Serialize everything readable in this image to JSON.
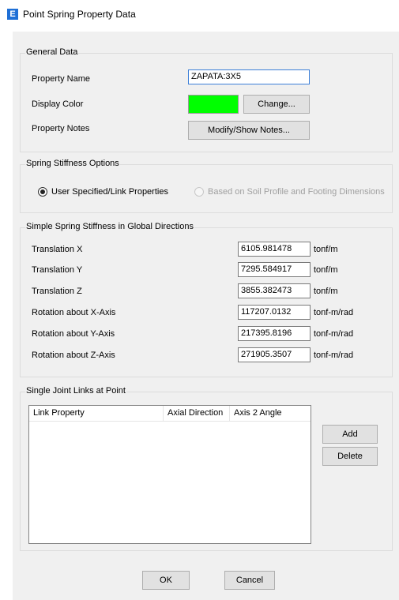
{
  "window": {
    "title": "Point Spring Property Data",
    "icon_letter": "E",
    "accent": "#1e6fd6"
  },
  "general": {
    "title": "General Data",
    "property_name_label": "Property Name",
    "property_name_value": "ZAPATA:3X5",
    "display_color_label": "Display Color",
    "display_color": "#00ff00",
    "change_button": "Change...",
    "property_notes_label": "Property Notes",
    "notes_button": "Modify/Show Notes..."
  },
  "stiffness_options": {
    "title": "Spring Stiffness Options",
    "option1": "User Specified/Link Properties",
    "option2": "Based on Soil Profile and Footing Dimensions",
    "selected": "option1"
  },
  "stiffness": {
    "title": "Simple Spring Stiffness in Global Directions",
    "rows": [
      {
        "label": "Translation  X",
        "value": "6105.981478",
        "unit": "tonf/m"
      },
      {
        "label": "Translation  Y",
        "value": "7295.584917",
        "unit": "tonf/m"
      },
      {
        "label": "Translation  Z",
        "value": "3855.382473",
        "unit": "tonf/m"
      },
      {
        "label": "Rotation about  X-Axis",
        "value": "117207.0132",
        "unit": "tonf-m/rad"
      },
      {
        "label": "Rotation about  Y-Axis",
        "value": "217395.8196",
        "unit": "tonf-m/rad"
      },
      {
        "label": "Rotation about  Z-Axis",
        "value": "271905.3507",
        "unit": "tonf-m/rad"
      }
    ]
  },
  "links": {
    "title": "Single Joint Links at Point",
    "columns": [
      "Link Property",
      "Axial Direction",
      "Axis 2 Angle"
    ],
    "add_button": "Add",
    "delete_button": "Delete"
  },
  "footer": {
    "ok": "OK",
    "cancel": "Cancel"
  }
}
